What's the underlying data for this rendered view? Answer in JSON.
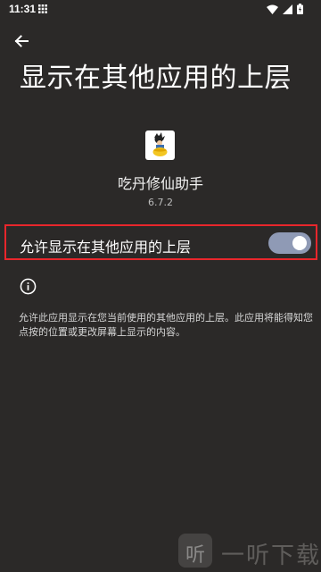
{
  "status_bar": {
    "time": "11:31",
    "icons": [
      "grid-notification-icon",
      "wifi-icon",
      "signal-icon",
      "battery-icon"
    ]
  },
  "navigation": {
    "back_icon": "arrow-left-icon"
  },
  "page": {
    "title": "显示在其他应用的上层"
  },
  "app": {
    "name": "吃丹修仙助手",
    "version": "6.7.2",
    "icon": "app-character-icon"
  },
  "permission": {
    "label": "允许显示在其他应用的上层",
    "enabled": true
  },
  "info": {
    "icon": "info-icon",
    "description": "允许此应用显示在您当前使用的其他应用的上层。此应用将能得知您点按的位置或更改屏幕上显示的内容。"
  },
  "watermark": {
    "logo_char": "听",
    "text": "一听下载"
  },
  "colors": {
    "background": "#2b2928",
    "highlight_border": "#e8262c",
    "switch_track": "#8f9ab5",
    "switch_thumb": "#ffffff"
  }
}
